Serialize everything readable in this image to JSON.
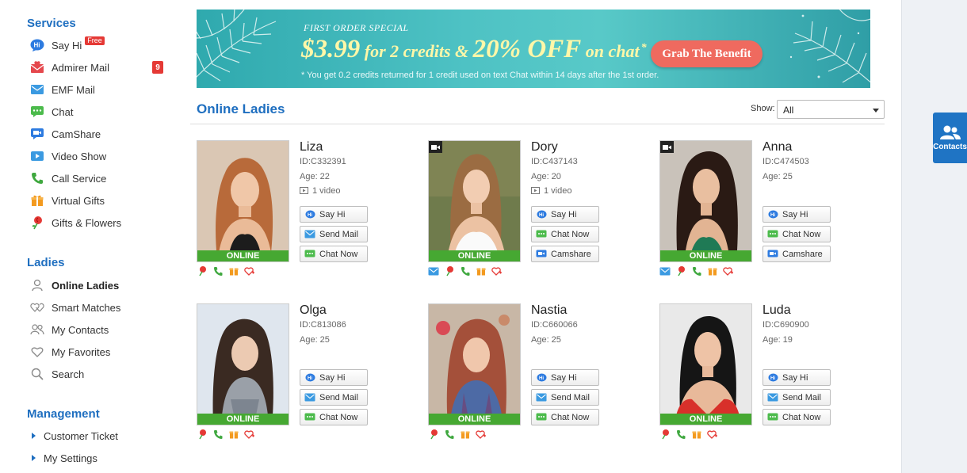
{
  "sidebar": {
    "services": {
      "title": "Services",
      "items": [
        {
          "label": "Say Hi",
          "badge": "Free"
        },
        {
          "label": "Admirer Mail",
          "count": "9"
        },
        {
          "label": "EMF Mail"
        },
        {
          "label": "Chat"
        },
        {
          "label": "CamShare"
        },
        {
          "label": "Video Show"
        },
        {
          "label": "Call Service"
        },
        {
          "label": "Virtual Gifts"
        },
        {
          "label": "Gifts & Flowers"
        }
      ]
    },
    "ladies": {
      "title": "Ladies",
      "items": [
        {
          "label": "Online Ladies"
        },
        {
          "label": "Smart Matches"
        },
        {
          "label": "My Contacts"
        },
        {
          "label": "My Favorites"
        },
        {
          "label": "Search"
        }
      ]
    },
    "management": {
      "title": "Management",
      "items": [
        {
          "label": "Customer Ticket"
        },
        {
          "label": "My Settings"
        }
      ]
    }
  },
  "banner": {
    "title": "FIRST ORDER SPECIAL",
    "price": "$3.99",
    "for_text": " for 2 credits & ",
    "discount": "20% OFF",
    "on_text": " on chat",
    "asterisk": "*",
    "note": "* You get 0.2 credits returned for 1 credit used on text Chat within 14 days after the 1st order.",
    "button": "Grab The Benefit"
  },
  "main": {
    "title": "Online Ladies",
    "show_label": "Show:",
    "show_value": "All"
  },
  "online_label": "ONLINE",
  "ladies": [
    {
      "name": "Liza",
      "id": "ID:C332391",
      "age": "Age: 22",
      "video": "1 video",
      "buttons": [
        "Say Hi",
        "Send Mail",
        "Chat Now"
      ]
    },
    {
      "name": "Dory",
      "id": "ID:C437143",
      "age": "Age: 20",
      "video": "1 video",
      "buttons": [
        "Say Hi",
        "Chat Now",
        "Camshare"
      ]
    },
    {
      "name": "Anna",
      "id": "ID:C474503",
      "age": "Age: 25",
      "buttons": [
        "Say Hi",
        "Chat Now",
        "Camshare"
      ]
    },
    {
      "name": "Olga",
      "id": "ID:C813086",
      "age": "Age: 25",
      "buttons": [
        "Say Hi",
        "Send Mail",
        "Chat Now"
      ]
    },
    {
      "name": "Nastia",
      "id": "ID:C660066",
      "age": "Age: 25",
      "buttons": [
        "Say Hi",
        "Send Mail",
        "Chat Now"
      ]
    },
    {
      "name": "Luda",
      "id": "ID:C690900",
      "age": "Age: 19",
      "buttons": [
        "Say Hi",
        "Send Mail",
        "Chat Now"
      ]
    }
  ],
  "contacts_tab": {
    "label": "Contacts"
  },
  "colors": {
    "accent": "#1f6fc0",
    "online": "#46a832",
    "badge": "#e53935"
  }
}
